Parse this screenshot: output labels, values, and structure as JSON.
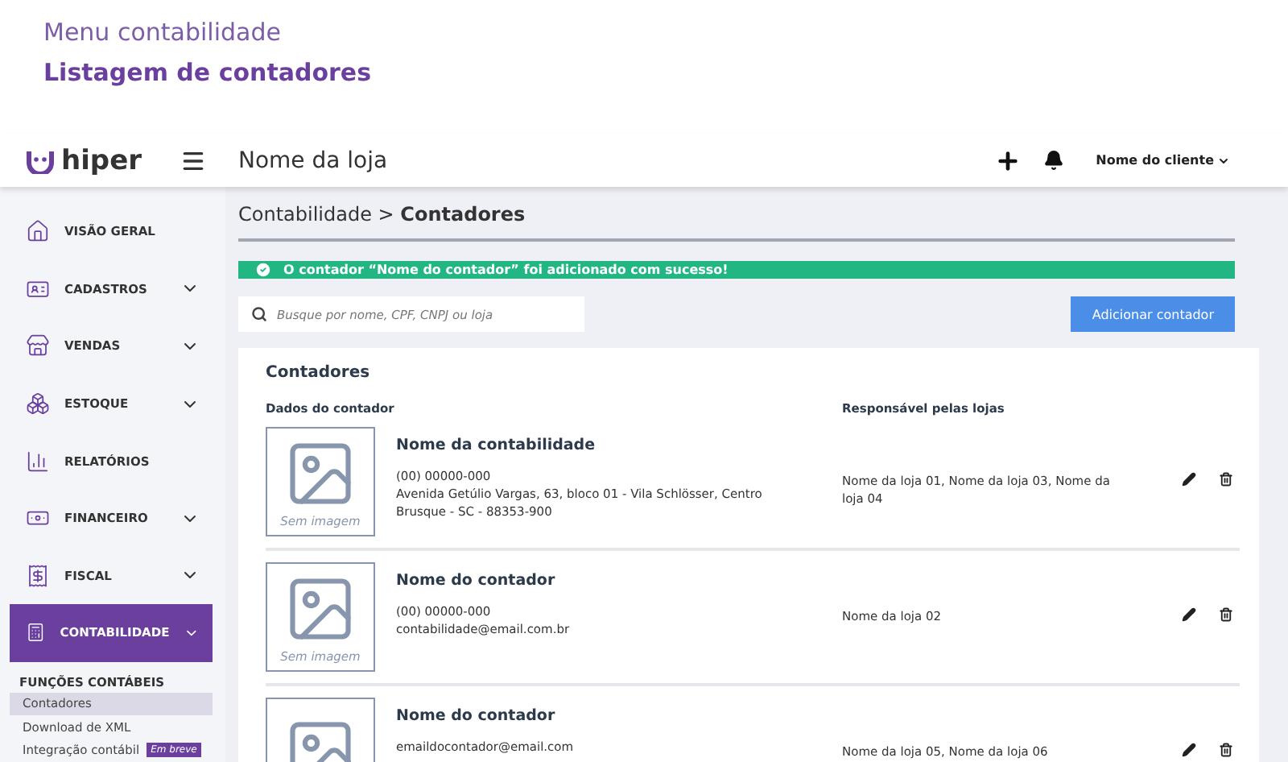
{
  "page_header": {
    "title": "Menu contabilidade",
    "subtitle": "Listagem de contadores"
  },
  "topbar": {
    "logo": "hiper",
    "store": "Nome da loja",
    "user": "Nome do cliente"
  },
  "sidebar": {
    "items": [
      {
        "label": "VISÃO GERAL",
        "kind": "link",
        "selected": false
      },
      {
        "label": "CADASTROS",
        "kind": "group",
        "selected": false
      },
      {
        "label": "VENDAS",
        "kind": "group",
        "selected": false
      },
      {
        "label": "ESTOQUE",
        "kind": "group",
        "selected": false
      },
      {
        "label": "RELATÓRIOS",
        "kind": "link",
        "selected": false
      },
      {
        "label": "FINANCEIRO",
        "kind": "group",
        "selected": false
      },
      {
        "label": "FISCAL",
        "kind": "group",
        "selected": false
      },
      {
        "label": "CONTABILIDADE",
        "kind": "group",
        "selected": true
      }
    ],
    "submenu": {
      "heading": "FUNÇÕES CONTÁBEIS",
      "items": [
        {
          "label": "Contadores",
          "selected": true
        },
        {
          "label": "Download de XML",
          "selected": false
        },
        {
          "label": "Integração contábil",
          "selected": false,
          "badge": "Em breve"
        }
      ]
    }
  },
  "breadcrumb": {
    "parent": "Contabilidade >",
    "current": "Contadores"
  },
  "alert": {
    "message": "O contador “Nome do contador” foi adicionado com sucesso!"
  },
  "search": {
    "placeholder": "Busque por nome, CPF, CNPJ ou loja"
  },
  "add_button": "Adicionar contador",
  "card": {
    "title": "Contadores",
    "columns": [
      "Dados do contador",
      "Responsável pelas lojas"
    ],
    "rows": [
      {
        "image_caption": "Sem imagem",
        "name": "Nome da contabilidade",
        "details": [
          "(00) 00000-000",
          "Avenida Getúlio Vargas, 63, bloco 01 - Vila Schlösser, Centro",
          "Brusque - SC - 88353-900"
        ],
        "stores": "Nome da loja 01, Nome da loja 03, Nome da loja 04"
      },
      {
        "image_caption": "Sem imagem",
        "name": "Nome do contador",
        "details": [
          "(00) 00000-000",
          "contabilidade@email.com.br"
        ],
        "stores": "Nome da loja 02"
      },
      {
        "name": "Nome do contador",
        "details": [
          "emaildocontador@email.com"
        ],
        "stores": "Nome da loja 05, Nome da loja 06"
      }
    ]
  }
}
